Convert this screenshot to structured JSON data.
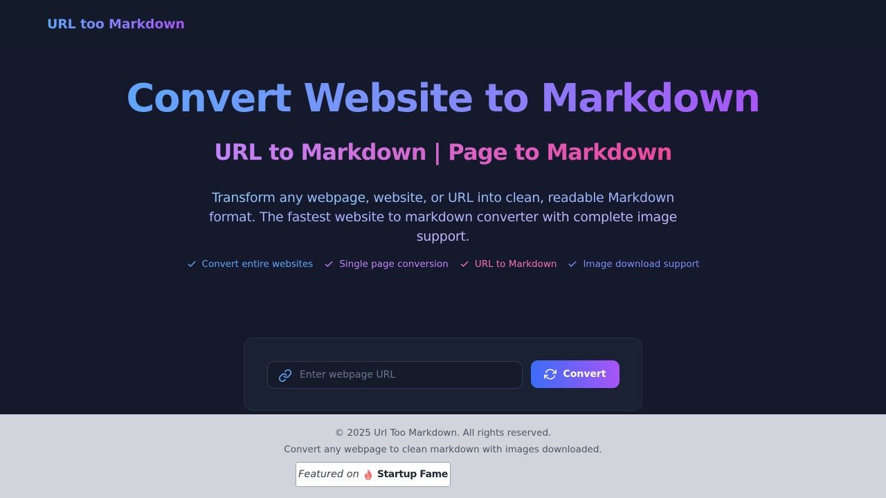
{
  "header": {
    "logo": "URL too Markdown"
  },
  "hero": {
    "title": "Convert Website to Markdown",
    "subtitle": "URL to Markdown | Page to Markdown",
    "description": "Transform any webpage, website, or URL into clean, readable Markdown format. The fastest website to markdown converter with complete image support."
  },
  "features": [
    {
      "label": "Convert entire websites",
      "color": "#60a5fa",
      "icon": "check-icon"
    },
    {
      "label": "Single page conversion",
      "color": "#c084fc",
      "icon": "check-icon"
    },
    {
      "label": "URL to Markdown",
      "color": "#f472b6",
      "icon": "check-icon"
    },
    {
      "label": "Image download support",
      "color": "#818cf8",
      "icon": "check-icon"
    }
  ],
  "converter": {
    "url_placeholder": "Enter webpage URL",
    "url_value": "",
    "convert_label": "Convert",
    "input_icon": "link-icon",
    "button_icon": "refresh-icon"
  },
  "footer": {
    "copyright": "© 2025 Url Too Markdown. All rights reserved.",
    "tagline": "Convert any webpage to clean markdown with images downloaded.",
    "badge_prefix": "Featured on",
    "badge_brand": "Startup Fame",
    "badge_icon": "flame-icon"
  },
  "colors": {
    "background": "#141a2b",
    "accent_blue": "#3b6cf6",
    "accent_purple": "#a855f7",
    "accent_pink": "#ec4899",
    "footer_bg": "#d1d5db"
  }
}
